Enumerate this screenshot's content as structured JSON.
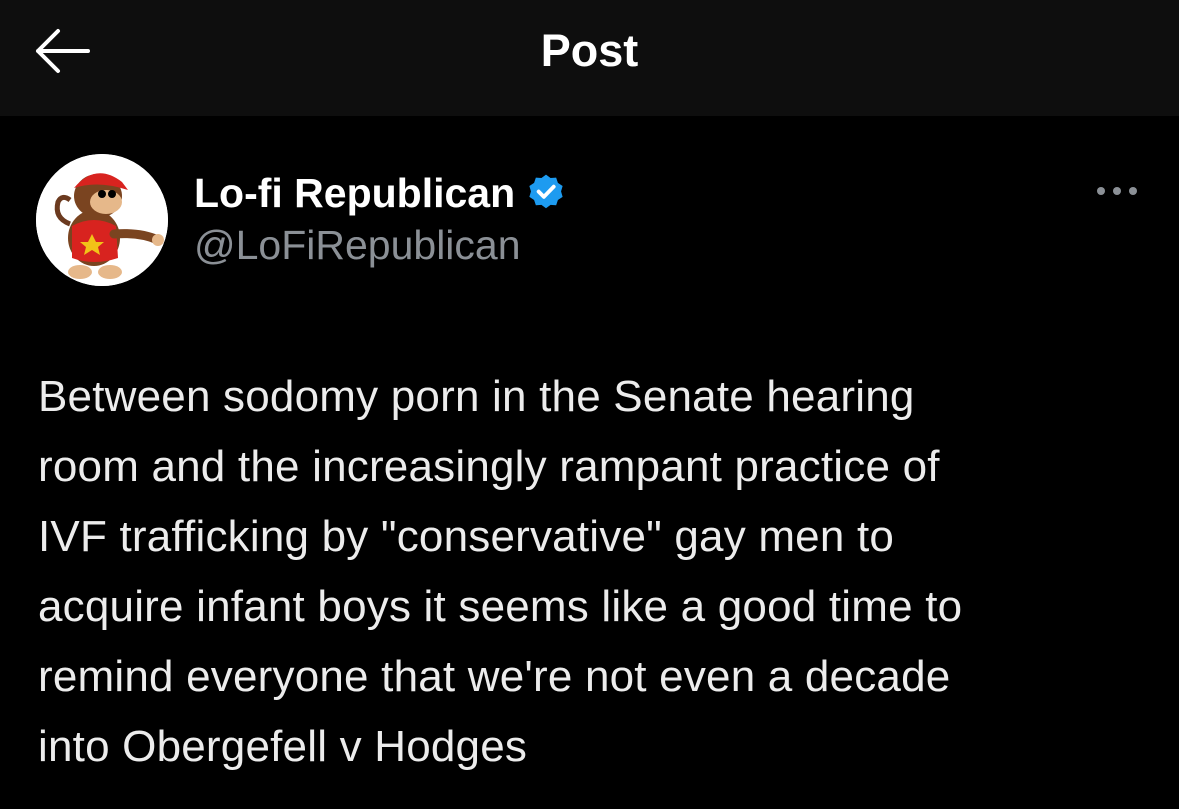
{
  "header": {
    "title": "Post",
    "back_icon": "arrow-left-icon"
  },
  "post": {
    "author": {
      "display_name": "Lo-fi Republican",
      "handle": "@LoFiRepublican",
      "verified": true,
      "verified_icon": "verified-badge-icon",
      "verified_color": "#1d9bf0",
      "avatar": "cartoon-monkey-avatar"
    },
    "more_icon": "more-horizontal-icon",
    "text": "Between sodomy porn in the Senate hearing\nroom and the increasingly rampant practice of\nIVF trafficking by \"conservative\" gay men to\nacquire infant boys it seems like a good time to\nremind everyone that we're not even a decade\ninto Obergefell v Hodges"
  },
  "colors": {
    "background": "#000000",
    "header_background": "#0e0e0e",
    "primary_text": "#ffffff",
    "secondary_text": "#8b9096",
    "accent": "#1d9bf0"
  }
}
